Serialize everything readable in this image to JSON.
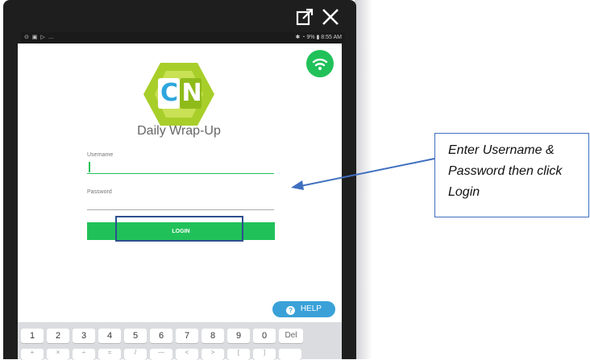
{
  "status_bar": {
    "left_text": "⊙ ▣ ▷ …",
    "right_text": "✱ ◔ 9% ▮ 8:55 AM"
  },
  "app": {
    "logo_letters": [
      "C",
      "N"
    ],
    "title": "Daily Wrap-Up",
    "username": {
      "label": "Username",
      "value": ""
    },
    "password": {
      "label": "Password",
      "value": ""
    },
    "login_label": "LOGIN",
    "help_label": "HELP"
  },
  "keyboard": {
    "row_numbers": [
      "1",
      "2",
      "3",
      "4",
      "5",
      "6",
      "7",
      "8",
      "9",
      "0",
      "Del"
    ],
    "row_symbols": [
      "+",
      "×",
      "÷",
      "=",
      "/",
      "—",
      "<",
      ">",
      "[",
      "]",
      ""
    ]
  },
  "callout": {
    "text": "Enter Username & Password then click Login"
  },
  "colors": {
    "accent_green": "#21c15a",
    "help_blue": "#3aa1d8",
    "annotation_blue": "#3f6fbf",
    "highlight_navy": "#2f4f8f",
    "logo_lime": "#a8ce2a"
  }
}
